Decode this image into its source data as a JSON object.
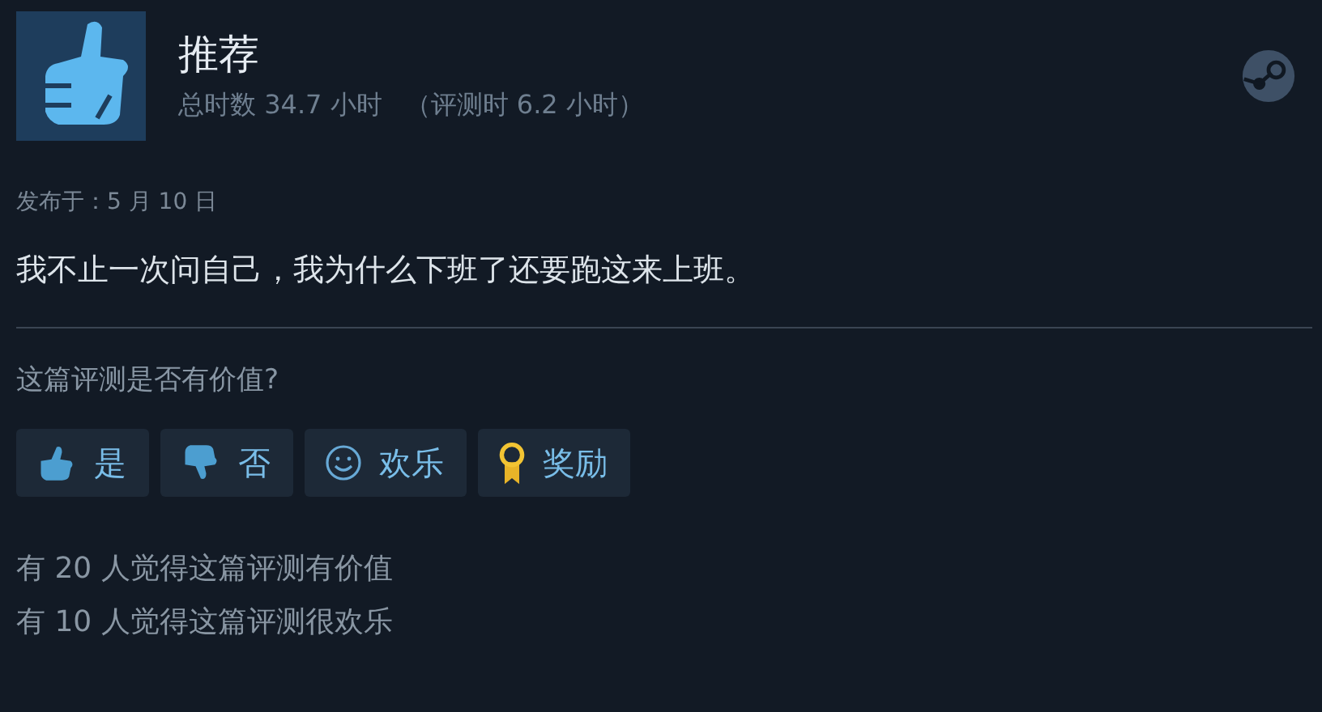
{
  "header": {
    "verdict": "推荐",
    "playtime": "总时数 34.7 小时",
    "review_playtime": "（评测时 6.2 小时）"
  },
  "posted": "发布于：5 月 10 日",
  "review_text": "我不止一次问自己，我为什么下班了还要跑这来上班。",
  "question": "这篇评测是否有价值?",
  "buttons": [
    {
      "kind": "thumb-up",
      "label": "是"
    },
    {
      "kind": "thumb-down",
      "label": "否"
    },
    {
      "kind": "smile",
      "label": "欢乐"
    },
    {
      "kind": "award",
      "label": "奖励"
    }
  ],
  "stats": [
    "有 20 人觉得这篇评测有价值",
    "有 10 人觉得这篇评测很欢乐"
  ]
}
